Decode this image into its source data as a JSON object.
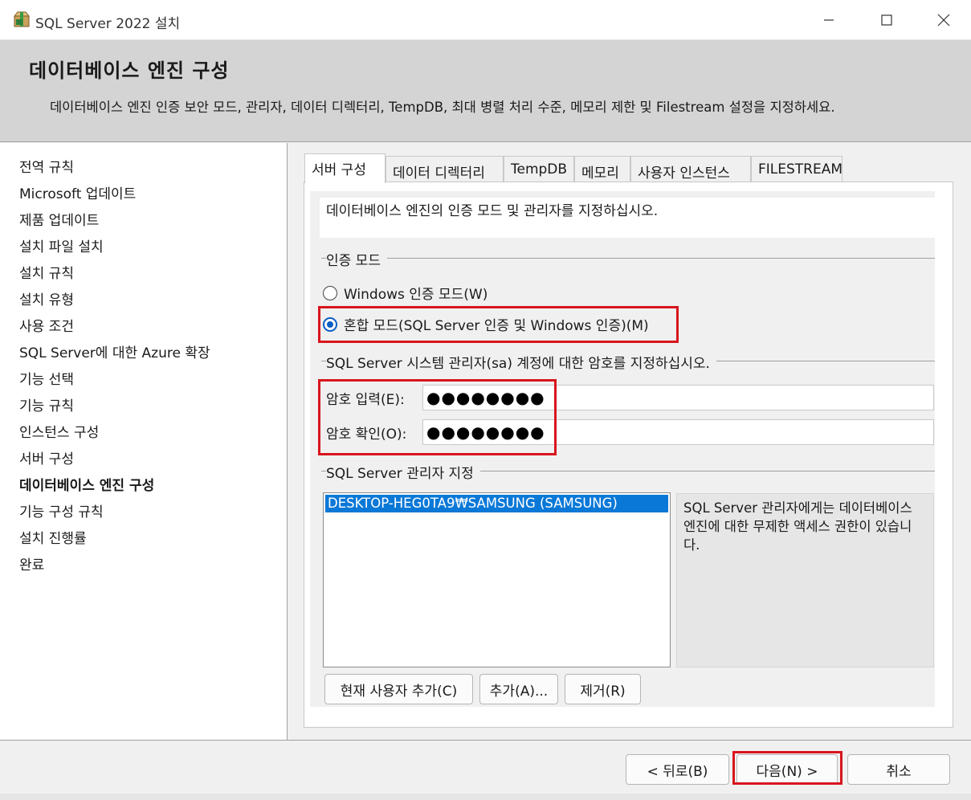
{
  "window": {
    "title": "SQL Server 2022 설치"
  },
  "header": {
    "title": "데이터베이스 엔진 구성",
    "description": "데이터베이스 엔진 인증 보안 모드, 관리자, 데이터 디렉터리, TempDB, 최대 병렬 처리 수준, 메모리 제한 및 Filestream 설정을 지정하세요."
  },
  "sidebar": {
    "items": [
      {
        "label": "전역 규칙"
      },
      {
        "label": "Microsoft 업데이트"
      },
      {
        "label": "제품 업데이트"
      },
      {
        "label": "설치 파일 설치"
      },
      {
        "label": "설치 규칙"
      },
      {
        "label": "설치 유형"
      },
      {
        "label": "사용 조건"
      },
      {
        "label": "SQL Server에 대한 Azure 확장"
      },
      {
        "label": "기능 선택"
      },
      {
        "label": "기능 규칙"
      },
      {
        "label": "인스턴스 구성"
      },
      {
        "label": "서버 구성"
      },
      {
        "label": "데이터베이스 엔진 구성"
      },
      {
        "label": "기능 구성 규칙"
      },
      {
        "label": "설치 진행률"
      },
      {
        "label": "완료"
      }
    ],
    "active": "데이터베이스 엔진 구성"
  },
  "tabs": [
    {
      "label": "서버 구성"
    },
    {
      "label": "데이터 디렉터리"
    },
    {
      "label": "TempDB"
    },
    {
      "label": "메모리"
    },
    {
      "label": "사용자 인스턴스"
    },
    {
      "label": "FILESTREAM"
    }
  ],
  "panel": {
    "description": "데이터베이스 엔진의 인증 모드 및 관리자를 지정하십시오.",
    "auth_group_label": "인증 모드",
    "auth_windows_label": "Windows 인증 모드(W)",
    "auth_mixed_label": "혼합 모드(SQL Server 인증 및 Windows 인증)(M)",
    "auth_selected": "혼합 모드",
    "sa_group_label": "SQL Server 시스템 관리자(sa) 계정에 대한 암호를 지정하십시오.",
    "password_label": "암호 입력(E):",
    "password_value": "●●●●●●●●",
    "confirm_label": "암호 확인(O):",
    "confirm_value": "●●●●●●●●",
    "admin_group_label": "SQL Server 관리자 지정",
    "admins": [
      "DESKTOP-HEG0TA9₩SAMSUNG (SAMSUNG)"
    ],
    "admin_info": "SQL Server 관리자에게는 데이터베이스 엔진에 대한 무제한 액세스 권한이 있습니다.",
    "add_current_user_button": "현재 사용자 추가(C)",
    "add_button": "추가(A)...",
    "remove_button": "제거(R)"
  },
  "footer": {
    "back_button": "< 뒤로(B)",
    "next_button": "다음(N) >",
    "cancel_button": "취소"
  },
  "colors": {
    "highlight_box": "#d8151d",
    "selection": "#0a78d7",
    "radio_accent": "#0a5fc2"
  }
}
